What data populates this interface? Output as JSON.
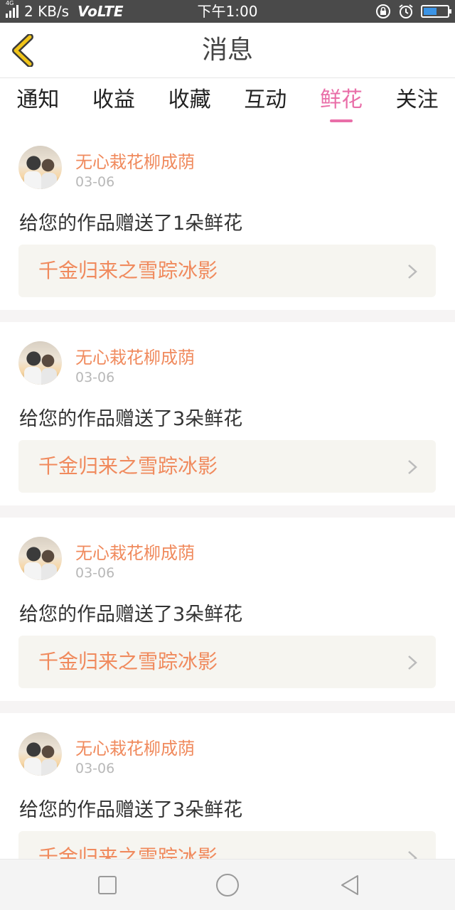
{
  "status_bar": {
    "network_tag": "4G",
    "speed": "2 KB/s",
    "volte": "VoLTE",
    "time": "下午1:00",
    "icons": [
      "signal-icon",
      "lock-rotation-icon",
      "alarm-icon",
      "battery-icon"
    ],
    "battery_color": "#3b94e6"
  },
  "header": {
    "title": "消息",
    "back_icon": "chevron-left-icon",
    "back_icon_color": "#f0c419"
  },
  "tabs": [
    {
      "label": "通知",
      "active": false
    },
    {
      "label": "收益",
      "active": false
    },
    {
      "label": "收藏",
      "active": false
    },
    {
      "label": "互动",
      "active": false
    },
    {
      "label": "鲜花",
      "active": true
    },
    {
      "label": "关注",
      "active": false
    }
  ],
  "accent_color": "#e96ea8",
  "name_color": "#f08a5d",
  "messages": [
    {
      "username": "无心栽花柳成荫",
      "date": "03-06",
      "text": "给您的作品赠送了1朵鲜花",
      "work_title": "千金归来之雪踪冰影"
    },
    {
      "username": "无心栽花柳成荫",
      "date": "03-06",
      "text": "给您的作品赠送了3朵鲜花",
      "work_title": "千金归来之雪踪冰影"
    },
    {
      "username": "无心栽花柳成荫",
      "date": "03-06",
      "text": "给您的作品赠送了3朵鲜花",
      "work_title": "千金归来之雪踪冰影"
    },
    {
      "username": "无心栽花柳成荫",
      "date": "03-06",
      "text": "给您的作品赠送了3朵鲜花",
      "work_title": "千金归来之雪踪冰影"
    }
  ],
  "nav_bar": {
    "icons": [
      "square-recents-icon",
      "circle-home-icon",
      "triangle-back-icon"
    ]
  }
}
